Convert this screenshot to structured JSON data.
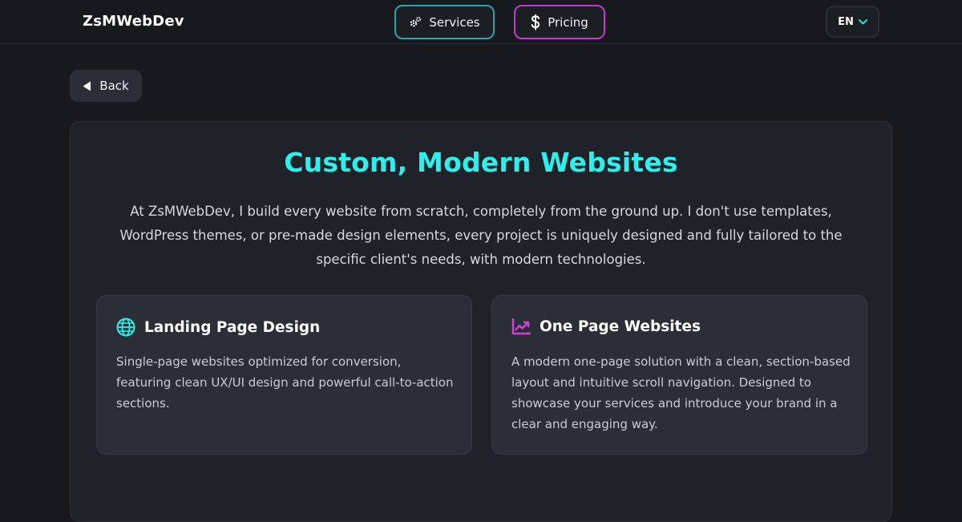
{
  "header": {
    "logo": "ZsMWebDev",
    "nav": {
      "services_label": "Services",
      "pricing_label": "Pricing"
    },
    "language": "EN"
  },
  "back_label": "Back",
  "main": {
    "title": "Custom, Modern Websites",
    "intro": "At ZsMWebDev, I build every website from scratch, completely from the ground up. I don't use templates, WordPress themes, or pre-made design elements, every project is uniquely designed and fully tailored to the specific client's needs, with modern technologies.",
    "cards": [
      {
        "icon": "globe-icon",
        "title": "Landing Page Design",
        "description": "Single-page websites optimized for conversion, featuring clean UX/UI design and powerful call-to-action sections."
      },
      {
        "icon": "trending-chart-icon",
        "title": "One Page Websites",
        "description": "A modern one-page solution with a clean, section-based layout and intuitive scroll navigation. Designed to showcase your services and introduce your brand in a clear and engaging way."
      }
    ]
  },
  "colors": {
    "accent_cyan": "#2ef0ea",
    "services_border": "#2fa3a6",
    "pricing_border": "#c23bd0",
    "chart_icon": "#d63fe0"
  }
}
